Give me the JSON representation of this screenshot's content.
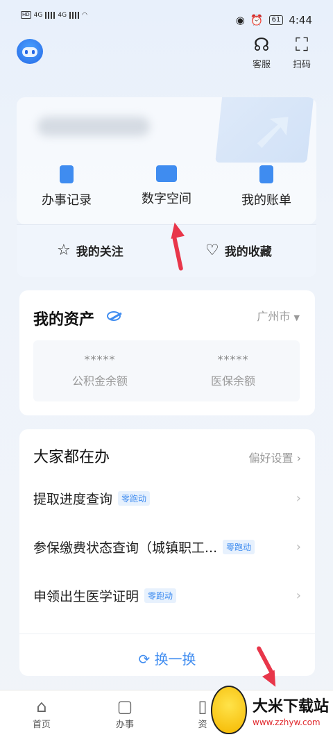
{
  "status": {
    "time": "4:44",
    "battery": "61",
    "network_left": "4G",
    "network_right": "4G",
    "hd": "HD"
  },
  "topbar": {
    "service_label": "客服",
    "scan_label": "扫码"
  },
  "quick_actions": [
    {
      "label": "办事记录"
    },
    {
      "label": "数字空间"
    },
    {
      "label": "我的账单"
    }
  ],
  "favorites": {
    "follow_label": "我的关注",
    "collect_label": "我的收藏"
  },
  "assets": {
    "title": "我的资产",
    "city": "广州市",
    "items": [
      {
        "value": "*****",
        "label": "公积金余额"
      },
      {
        "value": "*****",
        "label": "医保余额"
      }
    ]
  },
  "popular": {
    "title": "大家都在办",
    "pref_label": "偏好设置",
    "rows": [
      {
        "label": "提取进度查询",
        "badge": "零跑动"
      },
      {
        "label": "参保缴费状态查询（城镇职工...",
        "badge": "零跑动"
      },
      {
        "label": "申领出生医学证明",
        "badge": "零跑动"
      }
    ],
    "refresh_label": "换一换"
  },
  "tabbar": {
    "tabs": [
      {
        "label": "首页"
      },
      {
        "label": "办事"
      },
      {
        "label": "资"
      }
    ]
  },
  "watermark": {
    "title": "大米下载站",
    "url": "www.zzhyw.com"
  },
  "colors": {
    "accent": "#3f8cf0",
    "arrow": "#e8364a"
  }
}
